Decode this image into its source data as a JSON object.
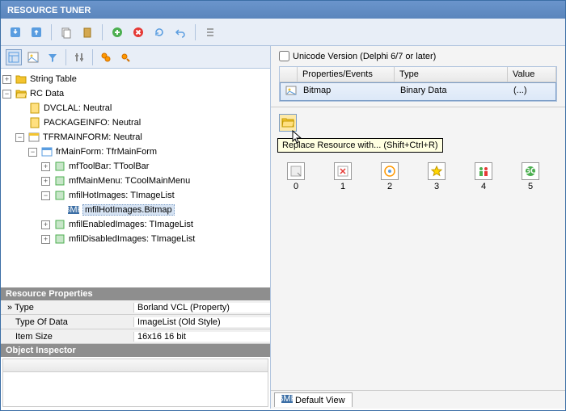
{
  "title": "RESOURCE TUNER",
  "tree": {
    "root1": "String Table",
    "root2": "RC Data",
    "n1": "DVCLAL: Neutral",
    "n2": "PACKAGEINFO: Neutral",
    "n3": "TFRMAINFORM: Neutral",
    "n4": "frMainForm: TfrMainForm",
    "n5": "mfToolBar: TToolBar",
    "n6": "mfMainMenu: TCoolMainMenu",
    "n7": "mfilHotImages: TImageList",
    "n8": "mfilHotImages.Bitmap",
    "n9": "mfilEnabledImages: TImageList",
    "n10": "mfilDisabledImages: TImageList"
  },
  "resProps": {
    "header": "Resource Properties",
    "rows": [
      {
        "k": "Type",
        "v": "Borland VCL (Property)"
      },
      {
        "k": "Type Of Data",
        "v": "ImageList (Old Style)"
      },
      {
        "k": "Item Size",
        "v": "16x16 16 bit"
      }
    ]
  },
  "inspector": {
    "header": "Object Inspector"
  },
  "right": {
    "checkbox": "Unicode Version (Delphi 6/7 or later)",
    "cols": {
      "c1": "Properties/Events",
      "c2": "Type",
      "c3": "Value"
    },
    "row": {
      "c1": "Bitmap",
      "c2": "Binary Data",
      "c3": "(...)"
    },
    "tooltip": "Replace Resource with... (Shift+Ctrl+R)",
    "indices": [
      "0",
      "1",
      "2",
      "3",
      "4",
      "5"
    ]
  },
  "tab": "Default View"
}
